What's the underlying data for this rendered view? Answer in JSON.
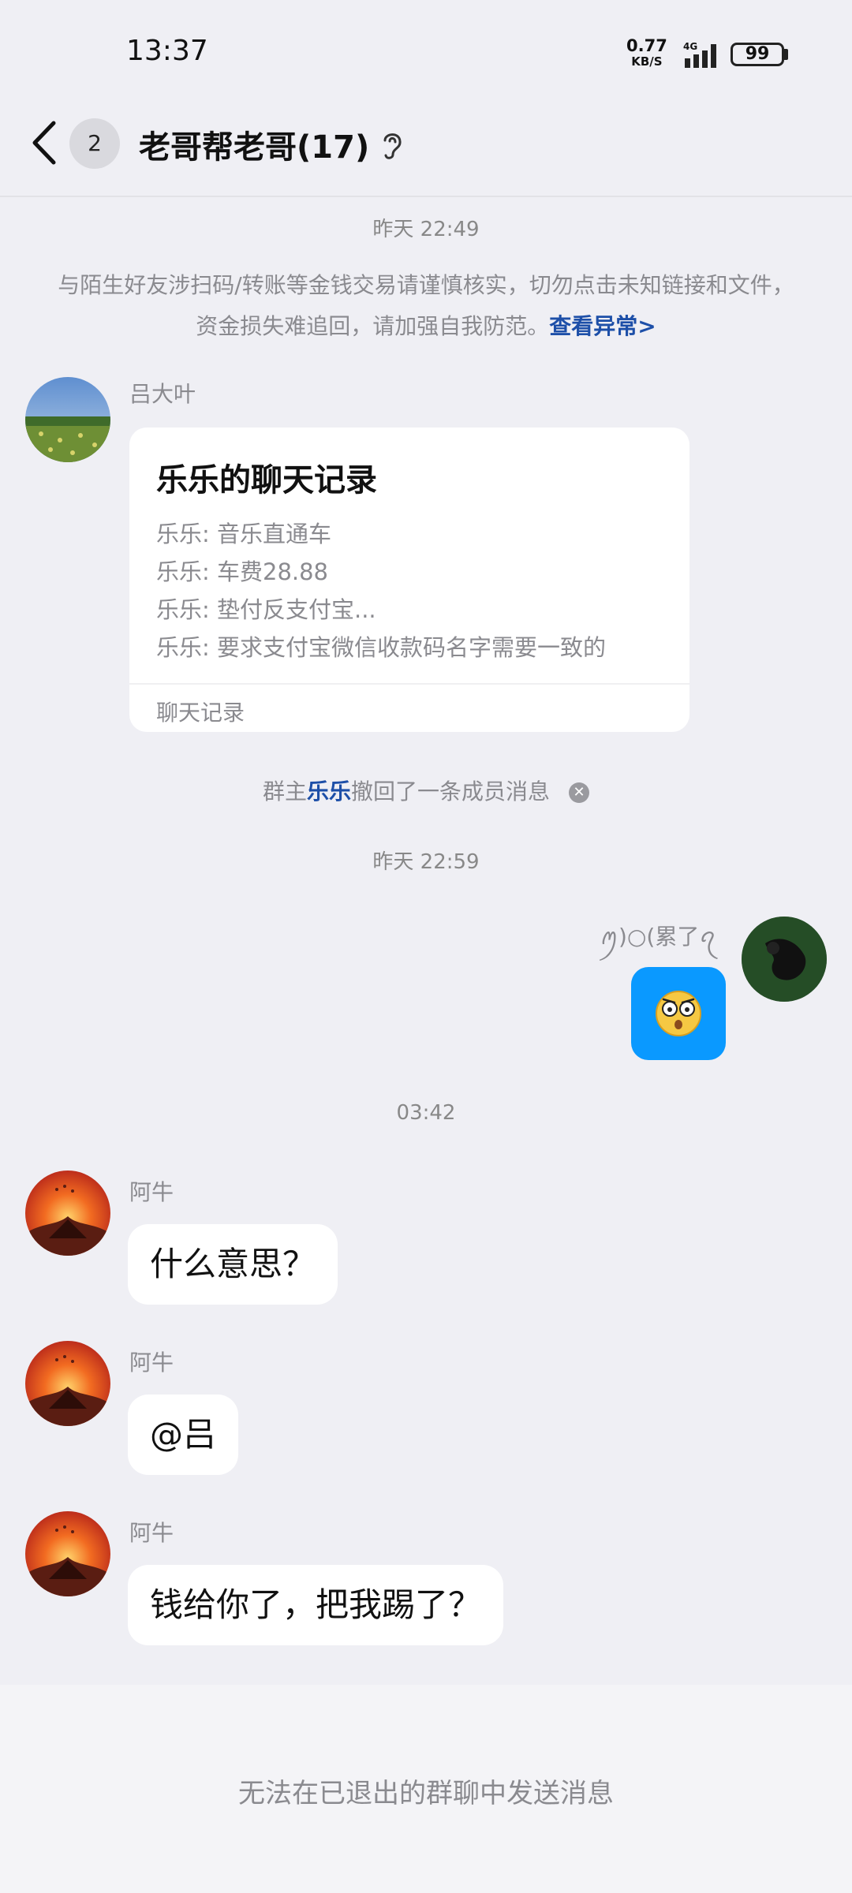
{
  "status_bar": {
    "time": "13:37",
    "net_speed_value": "0.77",
    "net_speed_unit": "KB/S",
    "network_type": "4G",
    "battery": "99"
  },
  "header": {
    "back_icon": "chevron-left-icon",
    "unread_count": "2",
    "title": "老哥帮老哥(17)",
    "ear_icon": "ear-icon"
  },
  "messages": {
    "timestamp_1": "昨天 22:49",
    "safety_notice": "与陌生好友涉扫码/转账等金钱交易请谨慎核实，切勿点击未知链接和文件，资金损失难追回，请加强自我防范。",
    "safety_link": "查看异常>",
    "forward": {
      "sender": "吕大叶",
      "card_title": "乐乐的聊天记录",
      "lines": [
        "乐乐: 音乐直通车",
        "乐乐: 车费28.88",
        "乐乐: 垫付反支付宝...",
        "乐乐: 要求支付宝微信收款码名字需要一致的"
      ],
      "footer": "聊天记录"
    },
    "recall": {
      "prefix": "群主",
      "name": "乐乐",
      "suffix": "撤回了一条成员消息"
    },
    "timestamp_2": "昨天 22:59",
    "my_name": "ꪑ)○(累了ꪖ",
    "timestamp_3": "03:42",
    "aniu_1": {
      "sender": "阿牛",
      "text": "什么意思？"
    },
    "aniu_2": {
      "sender": "阿牛",
      "text": "@吕"
    },
    "aniu_3": {
      "sender": "阿牛",
      "text": "钱给你了，把我踢了？"
    }
  },
  "footer": {
    "text": "无法在已退出的群聊中发送消息"
  },
  "colors": {
    "accent_link": "#1d4fa8",
    "emoji_bubble": "#0a99ff",
    "background": "#efeff4"
  }
}
